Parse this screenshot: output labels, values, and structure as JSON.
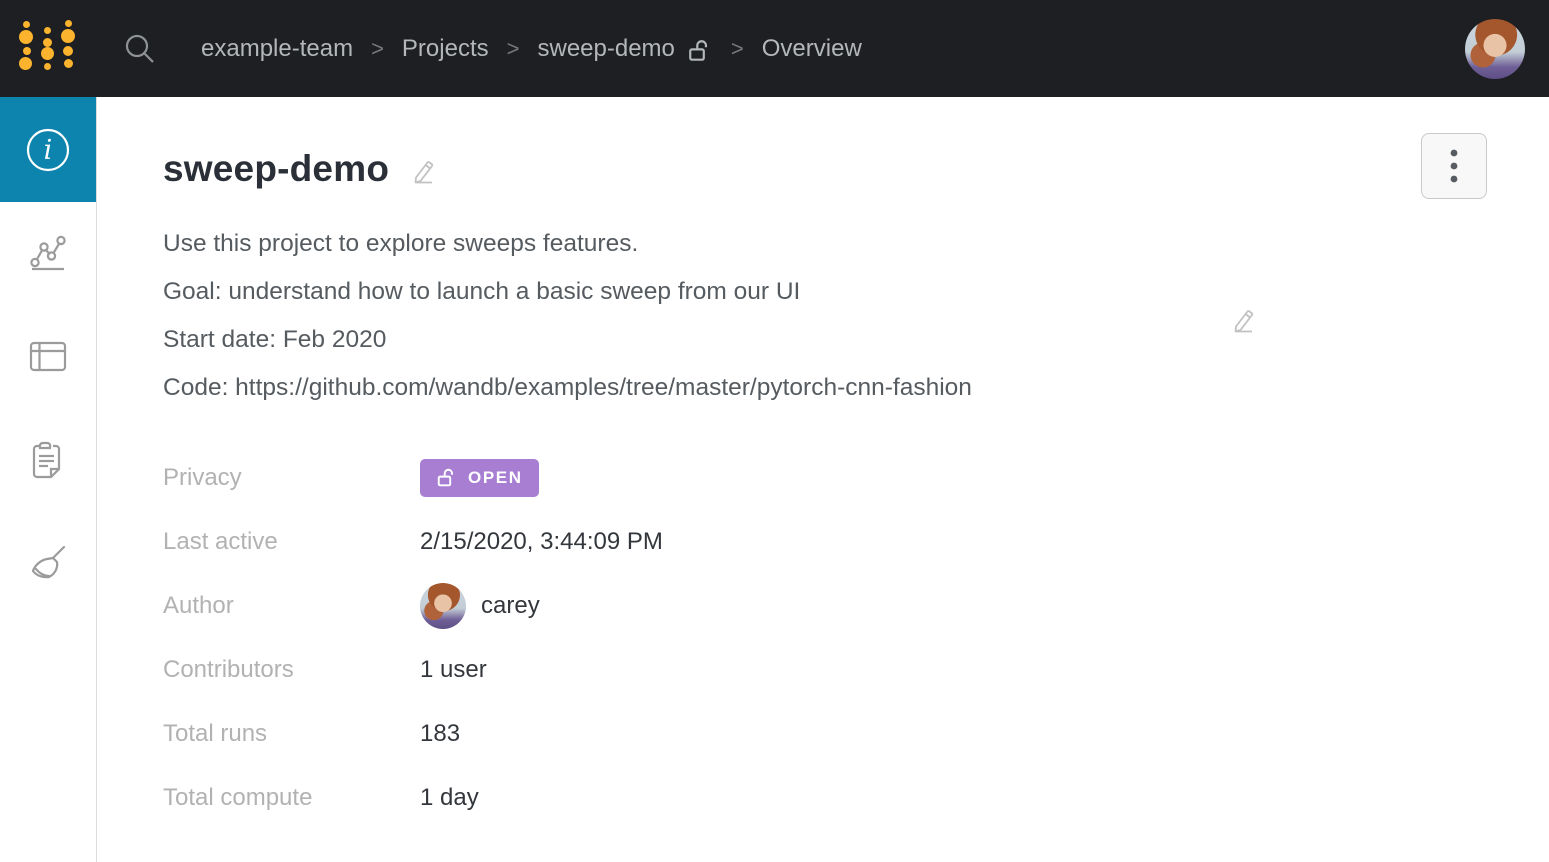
{
  "colors": {
    "topbar_bg": "#1d1f22",
    "logo_dot": "#fcb32d",
    "sidebar_active": "#0d84ad",
    "privacy_badge": "#a87ed3"
  },
  "topbar": {
    "breadcrumb": {
      "team": "example-team",
      "projects": "Projects",
      "project": "sweep-demo",
      "page": "Overview",
      "separator": ">"
    },
    "icons": [
      "wandb-logo",
      "search-icon",
      "unlocked-icon",
      "user-avatar"
    ]
  },
  "sidebar": {
    "items": [
      {
        "id": "overview",
        "icon": "info-icon",
        "active": true
      },
      {
        "id": "workspace",
        "icon": "line-chart-icon",
        "active": false
      },
      {
        "id": "runs-table",
        "icon": "table-icon",
        "active": false
      },
      {
        "id": "reports",
        "icon": "clipboard-icon",
        "active": false
      },
      {
        "id": "sweeps",
        "icon": "broom-icon",
        "active": false
      }
    ]
  },
  "main": {
    "title": "sweep-demo",
    "title_edit_icon": "pencil-icon",
    "kebab_icon": "kebab-menu-icon",
    "description_lines": [
      "Use this project to explore sweeps features.",
      "Goal: understand how to launch a basic sweep from our UI",
      "Start date: Feb 2020",
      "Code: https://github.com/wandb/examples/tree/master/pytorch-cnn-fashion"
    ],
    "privacy": {
      "label": "Privacy",
      "badge_label": "OPEN",
      "badge_icon": "unlocked-icon"
    },
    "rows": [
      {
        "label": "Last active",
        "value": "2/15/2020, 3:44:09 PM"
      },
      {
        "label": "Author",
        "value": "carey"
      },
      {
        "label": "Contributors",
        "value": "1 user"
      },
      {
        "label": "Total runs",
        "value": "183"
      },
      {
        "label": "Total compute",
        "value": "1 day"
      }
    ]
  }
}
